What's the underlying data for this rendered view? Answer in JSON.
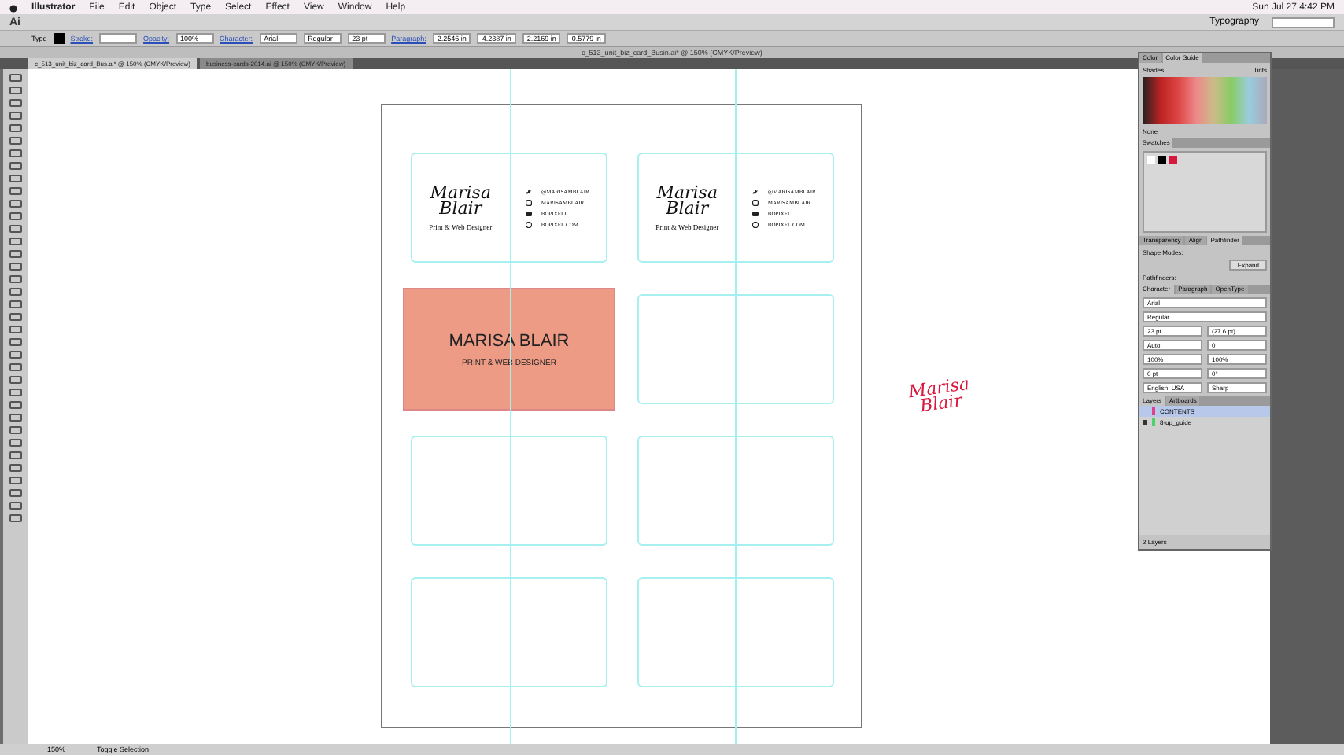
{
  "menubar": {
    "app": "Illustrator",
    "items": [
      "File",
      "Edit",
      "Object",
      "Type",
      "Select",
      "Effect",
      "View",
      "Window",
      "Help"
    ],
    "clock": "Sun Jul 27  4:42 PM"
  },
  "appbar": {
    "logo": "Ai",
    "workspace": "Typography"
  },
  "control_bar": [
    {
      "kind": "label",
      "text": "Type"
    },
    {
      "kind": "swatch"
    },
    {
      "kind": "link",
      "text": "Stroke:"
    },
    {
      "kind": "field"
    },
    {
      "kind": "link",
      "text": "Opacity:"
    },
    {
      "kind": "field",
      "text": "100%"
    },
    {
      "kind": "link",
      "text": "Character:"
    },
    {
      "kind": "field",
      "text": "Arial"
    },
    {
      "kind": "field",
      "text": "Regular"
    },
    {
      "kind": "field",
      "text": "23 pt"
    },
    {
      "kind": "link",
      "text": "Paragraph:"
    },
    {
      "kind": "field",
      "text": "2.2546 in"
    },
    {
      "kind": "field",
      "text": "4.2387 in"
    },
    {
      "kind": "field",
      "text": "2.2169 in"
    },
    {
      "kind": "field",
      "text": "0.5779 in"
    }
  ],
  "window_title": "c_513_unit_biz_card_Busin.ai* @ 150% (CMYK/Preview)",
  "doc_tabs": [
    {
      "label": "c_513_unit_biz_card_Bus.ai* @ 150% (CMYK/Preview)",
      "selected": true
    },
    {
      "label": "business-cards-2014.ai @ 150% (CMYK/Preview)",
      "selected": false
    }
  ],
  "cards": [
    {
      "kind": "front",
      "name": "Marisa\nBlair",
      "title": "Print & Web Designer",
      "contacts": [
        {
          "kind": "twitter",
          "text": "@MARISAMBLAIR"
        },
        {
          "kind": "instagram",
          "text": "MARISAMBLAIR"
        },
        {
          "kind": "youtube",
          "text": "BOPIXELL"
        },
        {
          "kind": "web",
          "text": "BOPIXEL.COM"
        }
      ]
    },
    {
      "kind": "front",
      "name": "Marisa\nBlair",
      "title": "Print & Web Designer",
      "contacts": [
        {
          "kind": "twitter",
          "text": "@MARISAMBLAIR"
        },
        {
          "kind": "instagram",
          "text": "MARISAMBLAIR"
        },
        {
          "kind": "youtube",
          "text": "BOPIXELL"
        },
        {
          "kind": "web",
          "text": "BOPIXEL.COM"
        }
      ]
    },
    {
      "kind": "back",
      "name": "MARISA BLAIR",
      "title": "PRINT & WEB DESIGNER",
      "color": "#ee9b86"
    },
    {
      "kind": "blank"
    },
    {
      "kind": "blank"
    },
    {
      "kind": "blank"
    },
    {
      "kind": "blank"
    },
    {
      "kind": "blank"
    }
  ],
  "floating_text": "Marisa\nBlair",
  "panels": {
    "color": {
      "tabs": [
        {
          "label": "Color",
          "selected": false
        },
        {
          "label": "Color Guide",
          "selected": true
        }
      ],
      "shades": "Shades",
      "tints": "Tints",
      "none": "None"
    },
    "swatches": {
      "tab": "Swatches"
    },
    "pathfinder": {
      "tabs": [
        {
          "label": "Transparency",
          "selected": false
        },
        {
          "label": "Align",
          "selected": false
        },
        {
          "label": "Pathfinder",
          "selected": true
        }
      ],
      "shape_modes": "Shape Modes:",
      "expand": "Expand",
      "pathfinders": "Pathfinders:"
    },
    "character": {
      "tabs": [
        {
          "label": "Character",
          "selected": true
        },
        {
          "label": "Paragraph",
          "selected": false
        },
        {
          "label": "OpenType",
          "selected": false
        }
      ],
      "font": "Arial",
      "style": "Regular",
      "fields": [
        "23 pt",
        "(27.6 pt)",
        "Auto",
        "0",
        "100%",
        "100%",
        "0 pt",
        "0°"
      ],
      "language": "English: USA",
      "antialias": "Sharp"
    },
    "layers": {
      "tabs": [
        {
          "label": "Layers",
          "selected": true
        },
        {
          "label": "Artboards",
          "selected": false
        }
      ],
      "rows": [
        {
          "name": "CONTENTS",
          "selected": true,
          "locked": false,
          "color": "#e0408a"
        },
        {
          "name": "8-up_guide",
          "selected": false,
          "locked": true,
          "color": "#4fd16a"
        }
      ],
      "count": "2 Layers"
    }
  },
  "status": {
    "zoom": "150%",
    "mode": "Toggle Selection"
  }
}
